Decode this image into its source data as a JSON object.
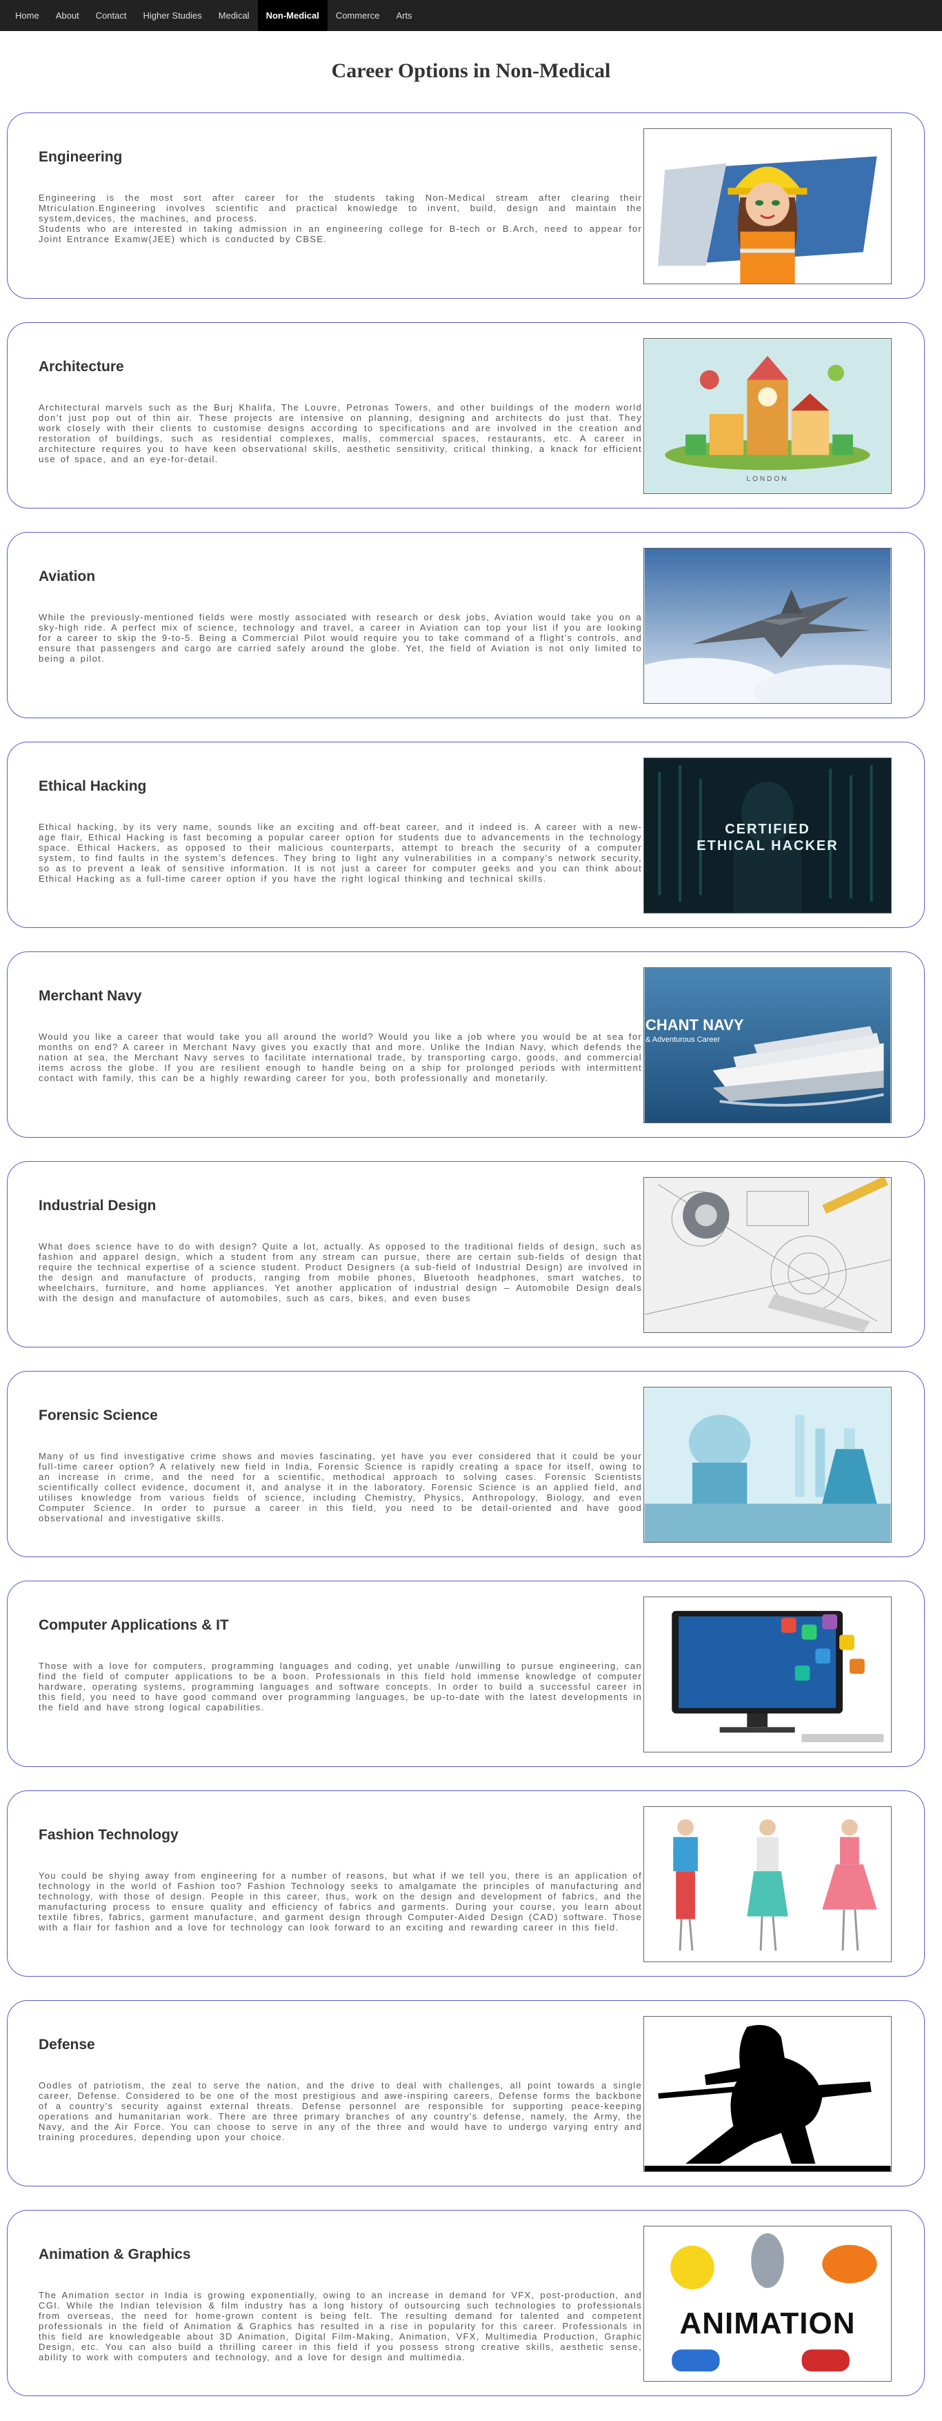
{
  "nav": {
    "items": [
      "Home",
      "About",
      "Contact",
      "Higher Studies",
      "Medical",
      "Non-Medical",
      "Commerce",
      "Arts"
    ],
    "active": "Non-Medical"
  },
  "page": {
    "title": "Career Options in Non-Medical"
  },
  "careers": [
    {
      "title": "Engineering",
      "paragraphs": [
        "Engineering is the most sort after career for the students taking Non-Medical stream after clearing their Mtriculation.Engineering involves scientific and practical knowledge to invent, build, design and maintain the system,devices, the machines, and process.",
        "Students who are interested in taking admission in an engineering college for B-tech or B.Arch, need to appear for Joint Entrance Examw(JEE) which is conducted by CBSE."
      ],
      "image": "engineer-illustration"
    },
    {
      "title": "Architecture",
      "paragraphs": [
        "Architectural marvels such as the Burj Khalifa, The Louvre, Petronas Towers, and other buildings of the modern world don’t just pop out of thin air. These projects are intensive on planning, designing and architects do just that. They work closely with their clients to customise designs according to specifications and are involved in the creation and restoration of buildings, such as residential complexes, malls, commercial spaces, restaurants, etc. A career in architecture requires you to have keen observational skills, aesthetic sensitivity, critical thinking, a knack for efficient use of space, and an eye-for-detail."
      ],
      "image": "london-illustration",
      "image_caption": "LONDON"
    },
    {
      "title": "Aviation",
      "paragraphs": [
        "While the previously-mentioned fields were mostly associated with research or desk jobs, Aviation would take you on a sky-high ride. A perfect mix of science, technology and travel, a career in Aviation can top your list if you are looking for a career to skip the 9-to-5. Being a Commercial Pilot would require you to take command of a flight’s controls, and ensure that passengers and cargo are carried safely around the globe. Yet, the field of Aviation is not only limited to being a pilot."
      ],
      "image": "fighter-jet-photo"
    },
    {
      "title": "Ethical Hacking",
      "paragraphs": [
        "Ethical hacking, by its very name, sounds like an exciting and off-beat career, and it indeed is. A career with a new-age flair, Ethical Hacking is fast becoming a popular career option for students due to advancements in the technology space. Ethical Hackers, as opposed to their malicious counterparts, attempt to breach the security of a computer system, to find faults in the system’s defences. They bring to light any vulnerabilities in a company’s network security, so as to prevent a leak of sensitive information. It is not just a career for computer geeks and you can think about Ethical Hacking as a full-time career option if you have the right logical thinking and technical skills."
      ],
      "image": "ethical-hacker-image",
      "image_caption_1": "CERTIFIED",
      "image_caption_2": "ETHICAL HACKER"
    },
    {
      "title": "Merchant Navy",
      "paragraphs": [
        "Would you like a career that would take you all around the world? Would you like a job where you would be at sea for months on end? A career in Merchant Navy gives you exactly that and more. Unlike the Indian Navy, which defends the nation at sea, the Merchant Navy serves to facilitate international trade, by transporting cargo, goods, and commercial items across the globe. If you are resilient enough to handle being on a ship for prolonged periods with intermittent contact with family, this can be a highly rewarding career for you, both professionally and monetarily."
      ],
      "image": "cruise-ship-photo",
      "image_caption_1": "CHANT NAVY",
      "image_caption_2": "& Adventurous Career"
    },
    {
      "title": "Industrial Design",
      "paragraphs": [
        "What does science have to do with design? Quite a lot, actually. As opposed to the traditional fields of design, such as fashion and apparel design, which a student from any stream can pursue, there are certain sub-fields of design that require the technical expertise of a science student. Product Designers (a sub-field of Industrial Design) are involved in the design and manufacture of products, ranging from mobile phones, Bluetooth headphones, smart watches, to wheelchairs, furniture, and home appliances. Yet another application of industrial design – Automobile Design deals with the design and manufacture of automobiles, such as cars, bikes, and even buses"
      ],
      "image": "technical-drawing-photo"
    },
    {
      "title": "Forensic Science",
      "paragraphs": [
        "Many of us find investigative crime shows and movies fascinating, yet have you ever considered that it could be your full-time career option? A relatively new field in India, Forensic Science is rapidly creating a space for itself, owing to an increase in crime, and the need for a scientific, methodical approach to solving cases. Forensic Scientists scientifically collect evidence, document it, and analyse it in the laboratory. Forensic Science is an applied field, and utilises knowledge from various fields of science, including Chemistry, Physics, Anthropology, Biology, and even Computer Science. In order to pursue a career in this field, you need to be detail-oriented and have good observational and investigative skills."
      ],
      "image": "laboratory-photo"
    },
    {
      "title": "Computer Applications & IT",
      "paragraphs": [
        "Those with a love for computers, programming languages and coding, yet unable /unwilling to pursue engineering, can find the field of computer applications to be a boon. Professionals in this field hold immense knowledge of computer hardware, operating systems, programming languages and software concepts. In order to build a successful career in this field, you need to have good command over programming languages, be up-to-date with the latest developments in the field and have strong logical capabilities."
      ],
      "image": "computer-monitor-image"
    },
    {
      "title": "Fashion Technology",
      "paragraphs": [
        "You could be shying away from engineering for a number of reasons, but what if we tell you, there is an application of technology in the world of Fashion too? Fashion Technology seeks to amalgamate the principles of manufacturing and technology, with those of design. People in this career, thus, work on the design and development of fabrics, and the manufacturing process to ensure quality and efficiency of fabrics and garments. During your course, you learn about textile fibres, fabrics, garment manufacture, and garment design through Computer-Aided Design (CAD) software. Those with a flair for fashion and a love for technology can look forward to an exciting and rewarding career in this field."
      ],
      "image": "fashion-sketch-image"
    },
    {
      "title": "Defense",
      "paragraphs": [
        "Oodles of patriotism, the zeal to serve the nation, and the drive to deal with challenges, all point towards a single career, Defense. Considered to be one of the most prestigious and awe-inspiring careers, Defense forms the backbone of a country’s security against external threats. Defense personnel are responsible for supporting peace-keeping operations and humanitarian work. There are three primary branches of any country’s defense, namely, the Army, the Navy, and the Air Force. You can choose to serve in any of the three and would have to undergo varying entry and training procedures, depending upon your choice."
      ],
      "image": "soldier-silhouette-image"
    },
    {
      "title": "Animation & Graphics",
      "paragraphs": [
        "The Animation sector in India is growing exponentially, owing to an increase in demand for VFX, post-production, and CGI. While the Indian television & film industry has a long history of outsourcing such technologies to professionals from overseas, the need for home-grown content is being felt. The resulting demand for talented and competent professionals in the field of Animation & Graphics has resulted in a rise in popularity for this career. Professionals in this field are knowledgeable about 3D Animation, Digital Film-Making, Animation, VFX, Multimedia Production, Graphic Design, etc. You can also build a thrilling career in this field if you possess strong creative skills, aesthetic sense, ability to work with computers and technology, and a love for design and multimedia."
      ],
      "image": "animation-characters-image",
      "image_caption": "ANIMATION"
    }
  ],
  "colors": {
    "nav_bg": "#222222",
    "nav_active_bg": "#000000",
    "card_border": "#5b5bd6",
    "text": "#555555"
  }
}
